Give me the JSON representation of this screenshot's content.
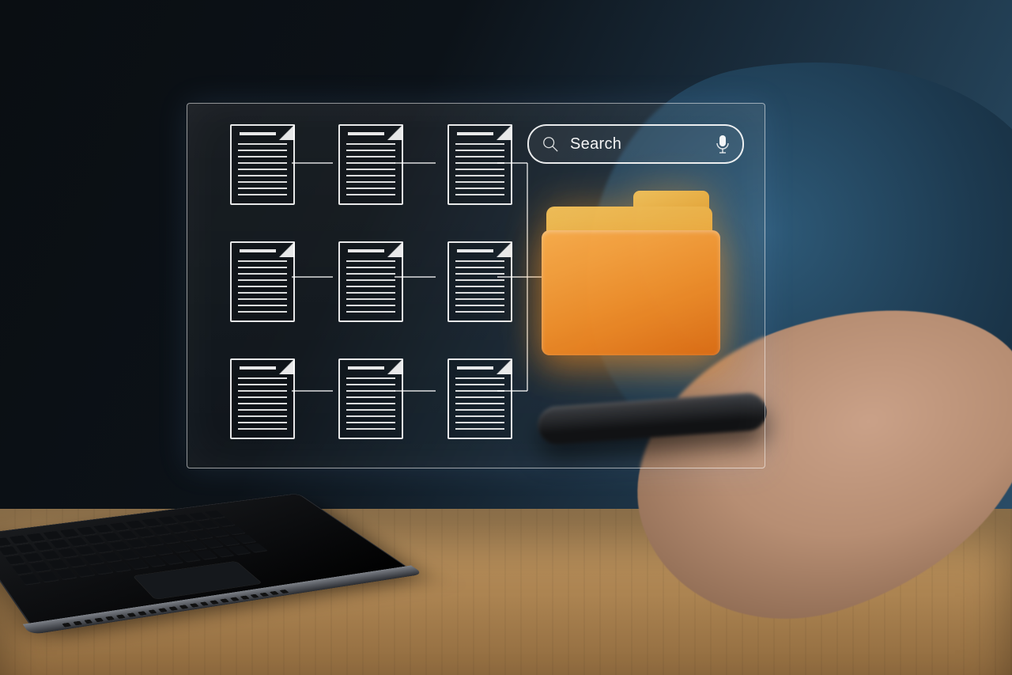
{
  "search": {
    "placeholder": "Search"
  },
  "icons": {
    "magnifier": "search-icon",
    "microphone": "microphone-icon",
    "document": "document-icon",
    "folder": "folder-icon"
  },
  "grid": {
    "rows": 3,
    "cols": 3
  }
}
